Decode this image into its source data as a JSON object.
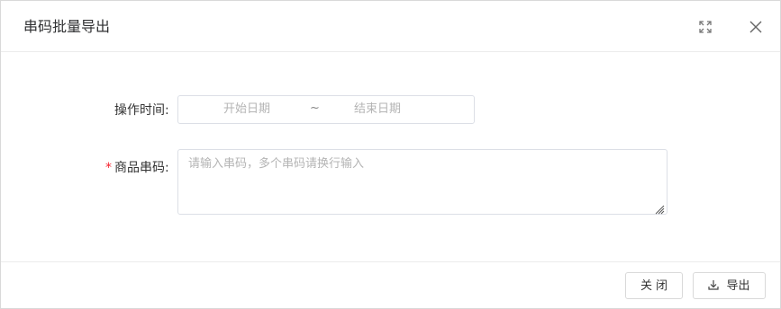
{
  "dialog": {
    "title": "串码批量导出",
    "icons": {
      "maximize": "maximize-icon",
      "close": "close-icon"
    }
  },
  "form": {
    "time_label": "操作时间:",
    "date_range": {
      "start_placeholder": "开始日期",
      "separator": "~",
      "end_placeholder": "结束日期"
    },
    "code_required_mark": "*",
    "code_label": "商品串码:",
    "code_placeholder": "请输入串码，多个串码请换行输入"
  },
  "footer": {
    "close_label": "关闭",
    "export_label": "导出",
    "export_icon": "download-icon"
  },
  "colors": {
    "required": "#f5222d",
    "placeholder": "#b4b4b4",
    "border": "#dcdfe6"
  }
}
